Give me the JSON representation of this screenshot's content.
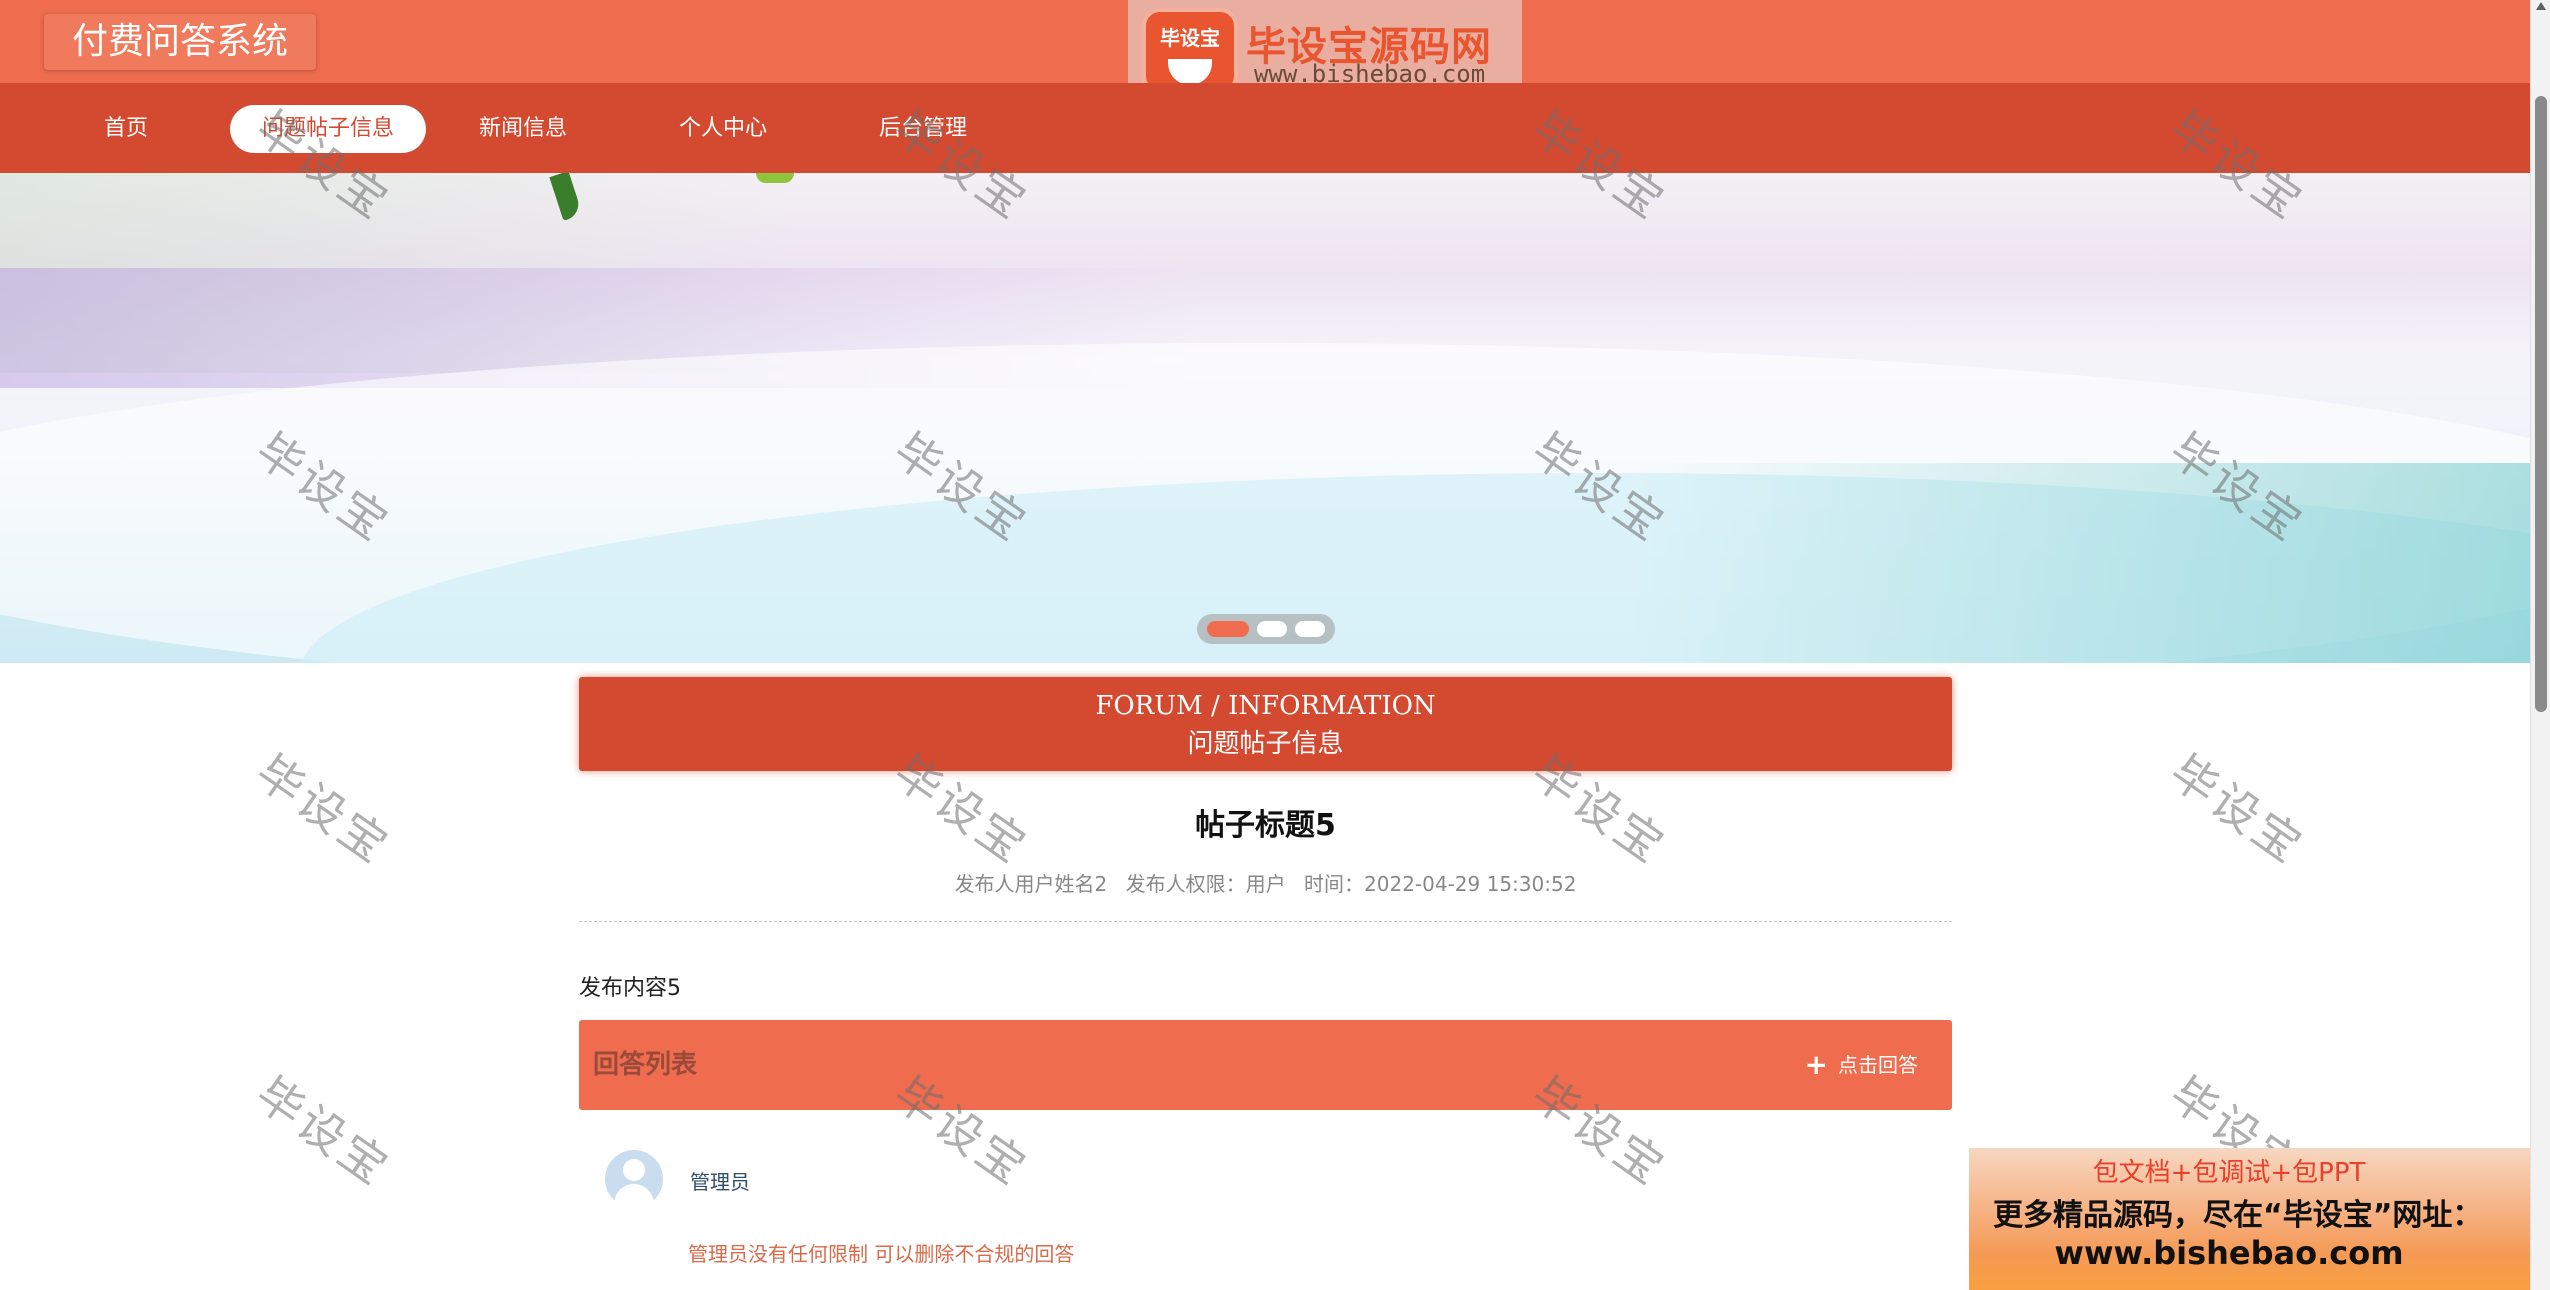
{
  "header": {
    "app_title": "付费问答系统",
    "brand_badge": "毕设宝",
    "brand_title": "毕设宝源码网",
    "brand_url": "www.bishebao.com"
  },
  "nav": {
    "items": [
      {
        "label": "首页"
      },
      {
        "label": "问题帖子信息",
        "active": true
      },
      {
        "label": "新闻信息"
      },
      {
        "label": "个人中心"
      },
      {
        "label": "后台管理"
      }
    ]
  },
  "banner": {
    "slides": 3,
    "active_slide": 1
  },
  "section": {
    "title_en": "FORUM / INFORMATION",
    "title_cn": "问题帖子信息"
  },
  "post": {
    "title": "帖子标题5",
    "author": "发布人用户姓名2",
    "role": "发布人权限：用户",
    "time": "时间：2022-04-29 15:30:52",
    "content": "发布内容5"
  },
  "answers": {
    "title": "回答列表",
    "add_button": "点击回答",
    "items": [
      {
        "user": "管理员",
        "text": "管理员没有任何限制 可以删除不合规的回答"
      }
    ]
  },
  "watermark": "毕设宝",
  "promo": {
    "line1": "包文档+包调试+包PPT",
    "line2": "更多精品源码，尽在“毕设宝”网址：",
    "line3": "www.bishebao.com"
  },
  "colors": {
    "header": "#ef6c4e",
    "nav": "#d44a31",
    "accent": "#ef6c4e"
  },
  "icons": {
    "add": "plus-icon",
    "avatar": "user-avatar-icon"
  }
}
